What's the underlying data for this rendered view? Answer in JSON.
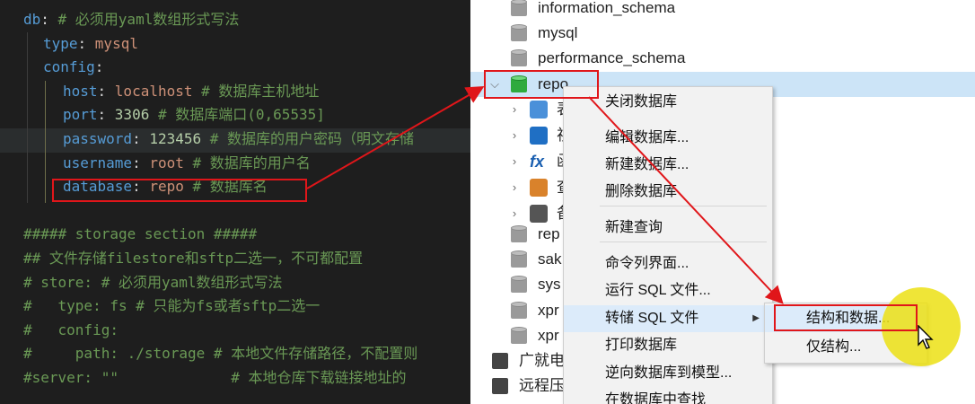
{
  "editor": {
    "lines": [
      {
        "indent": "",
        "parts": [
          {
            "t": "key",
            "s": "db"
          },
          {
            "t": "plain",
            "s": ": "
          },
          {
            "t": "com",
            "s": "# 必须用yaml数组形式写法"
          }
        ]
      },
      {
        "indent": "  ",
        "parts": [
          {
            "t": "key",
            "s": "type"
          },
          {
            "t": "plain",
            "s": ": "
          },
          {
            "t": "val",
            "s": "mysql"
          }
        ]
      },
      {
        "indent": "  ",
        "parts": [
          {
            "t": "key",
            "s": "config"
          },
          {
            "t": "plain",
            "s": ":"
          }
        ]
      },
      {
        "indent": "    ",
        "parts": [
          {
            "t": "key",
            "s": "host"
          },
          {
            "t": "plain",
            "s": ": "
          },
          {
            "t": "val",
            "s": "localhost"
          },
          {
            "t": "com",
            "s": " # 数据库主机地址"
          }
        ]
      },
      {
        "indent": "    ",
        "parts": [
          {
            "t": "key",
            "s": "port"
          },
          {
            "t": "plain",
            "s": ": "
          },
          {
            "t": "num",
            "s": "3306"
          },
          {
            "t": "com",
            "s": " # 数据库端口(0,65535]"
          }
        ]
      },
      {
        "indent": "    ",
        "parts": [
          {
            "t": "key",
            "s": "password"
          },
          {
            "t": "plain",
            "s": ": "
          },
          {
            "t": "num",
            "s": "123456"
          },
          {
            "t": "com",
            "s": " # 数据库的用户密码（明文存储"
          }
        ]
      },
      {
        "indent": "    ",
        "parts": [
          {
            "t": "key",
            "s": "username"
          },
          {
            "t": "plain",
            "s": ": "
          },
          {
            "t": "val",
            "s": "root"
          },
          {
            "t": "com",
            "s": " # 数据库的用户名"
          }
        ]
      },
      {
        "indent": "    ",
        "parts": [
          {
            "t": "key",
            "s": "database"
          },
          {
            "t": "plain",
            "s": ": "
          },
          {
            "t": "val",
            "s": "repo"
          },
          {
            "t": "com",
            "s": " # 数据库名"
          }
        ]
      },
      {
        "indent": "",
        "parts": []
      },
      {
        "indent": "",
        "parts": [
          {
            "t": "com",
            "s": "##### storage section #####"
          }
        ]
      },
      {
        "indent": "",
        "parts": [
          {
            "t": "com",
            "s": "## 文件存储filestore和sftp二选一，不可都配置"
          }
        ]
      },
      {
        "indent": "",
        "parts": [
          {
            "t": "com",
            "s": "# store: # 必须用yaml数组形式写法"
          }
        ]
      },
      {
        "indent": "",
        "parts": [
          {
            "t": "com",
            "s": "#   type: fs # 只能为fs或者sftp二选一"
          }
        ]
      },
      {
        "indent": "",
        "parts": [
          {
            "t": "com",
            "s": "#   config:"
          }
        ]
      },
      {
        "indent": "",
        "parts": [
          {
            "t": "com",
            "s": "#     path: ./storage # 本地文件存储路径，不配置则"
          }
        ]
      },
      {
        "indent": "",
        "parts": [
          {
            "t": "com",
            "s": "#server: \"\"             # 本地仓库下载链接地址的"
          }
        ]
      }
    ]
  },
  "tree": {
    "databases_top": [
      "information_schema",
      "mysql",
      "performance_schema"
    ],
    "selected_db": "repo",
    "children_truncated": [
      "表",
      "视",
      "函",
      "查",
      "备"
    ],
    "databases_bottom": [
      "rep",
      "sak",
      "sys",
      "xpr",
      "xpr"
    ],
    "connections": [
      "广就电",
      "远程压"
    ]
  },
  "context_menu": {
    "items": [
      {
        "label": "关闭数据库"
      },
      {
        "label": "编辑数据库..."
      },
      {
        "label": "新建数据库..."
      },
      {
        "label": "删除数据库"
      },
      {
        "label": "新建查询"
      },
      {
        "label": "命令列界面..."
      },
      {
        "label": "运行 SQL 文件..."
      },
      {
        "label": "转储 SQL 文件"
      },
      {
        "label": "打印数据库"
      },
      {
        "label": "逆向数据库到模型..."
      },
      {
        "label": "在数据库中查找"
      }
    ],
    "submenu_arrow": "▶"
  },
  "submenu": {
    "items": [
      {
        "label": "结构和数据..."
      },
      {
        "label": "仅结构..."
      }
    ]
  },
  "colors": {
    "annotation_red": "#e0161a",
    "highlight_yellow": "#ece014",
    "selected_row": "#cce4f7"
  }
}
